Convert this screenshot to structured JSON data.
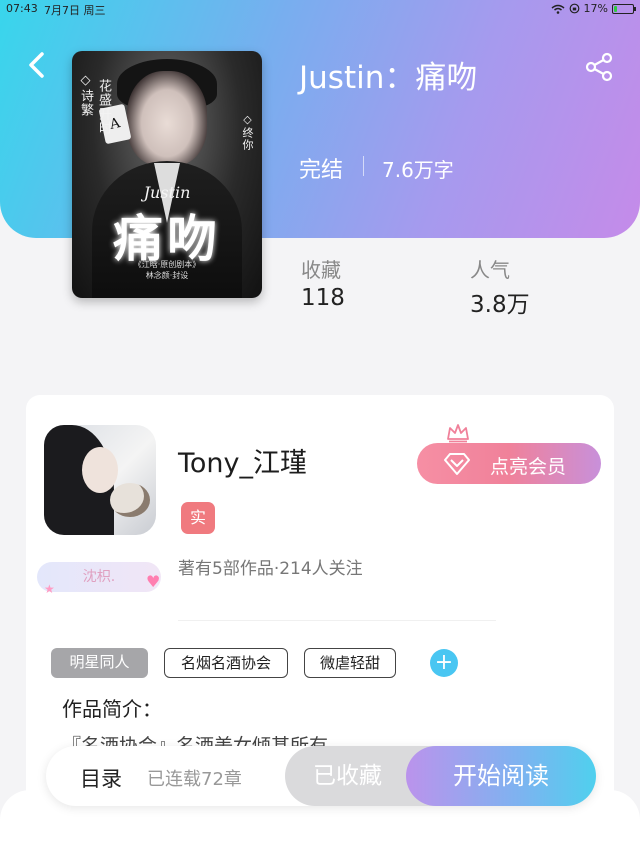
{
  "status_bar": {
    "time": "07:43",
    "date": "7月7日 周三",
    "battery": "17%",
    "battery_level": 0.17
  },
  "book": {
    "title": "Justin：痛吻",
    "status": "完结",
    "word_count": "7.6万字",
    "cover": {
      "vertical_text_1": "◇诗繁",
      "vertical_text_2": "花盛开时",
      "vertical_text_3": "◇终你",
      "card_letter": "A",
      "name": "Justin",
      "title": "痛吻",
      "info_line_1": "《江晗·原创剧本》",
      "info_line_2": "林念颜·封设"
    }
  },
  "stats": {
    "collect_label": "收藏",
    "collect_value": "118",
    "popularity_label": "人气",
    "popularity_value": "3.8万"
  },
  "author": {
    "name": "Tony_江瑾",
    "badge": "实",
    "meta": "著有5部作品·214人关注",
    "frame_tag": "沈枳.",
    "vip_button": "点亮会员"
  },
  "tags": [
    "明星同人",
    "名烟名酒协会",
    "微虐轻甜"
  ],
  "add_tag": "+",
  "intro": {
    "label": "作品简介：",
    "text": "『名酒协会』名酒美女倾甚所有"
  },
  "bottom": {
    "toc": "目录",
    "chapters": "已连载72章",
    "collected": "已收藏",
    "read": "开始阅读"
  },
  "colors": {
    "accent_pink": "#f0819a",
    "accent_blue": "#49c6f2",
    "vip_gradient_end": "#c890da"
  }
}
